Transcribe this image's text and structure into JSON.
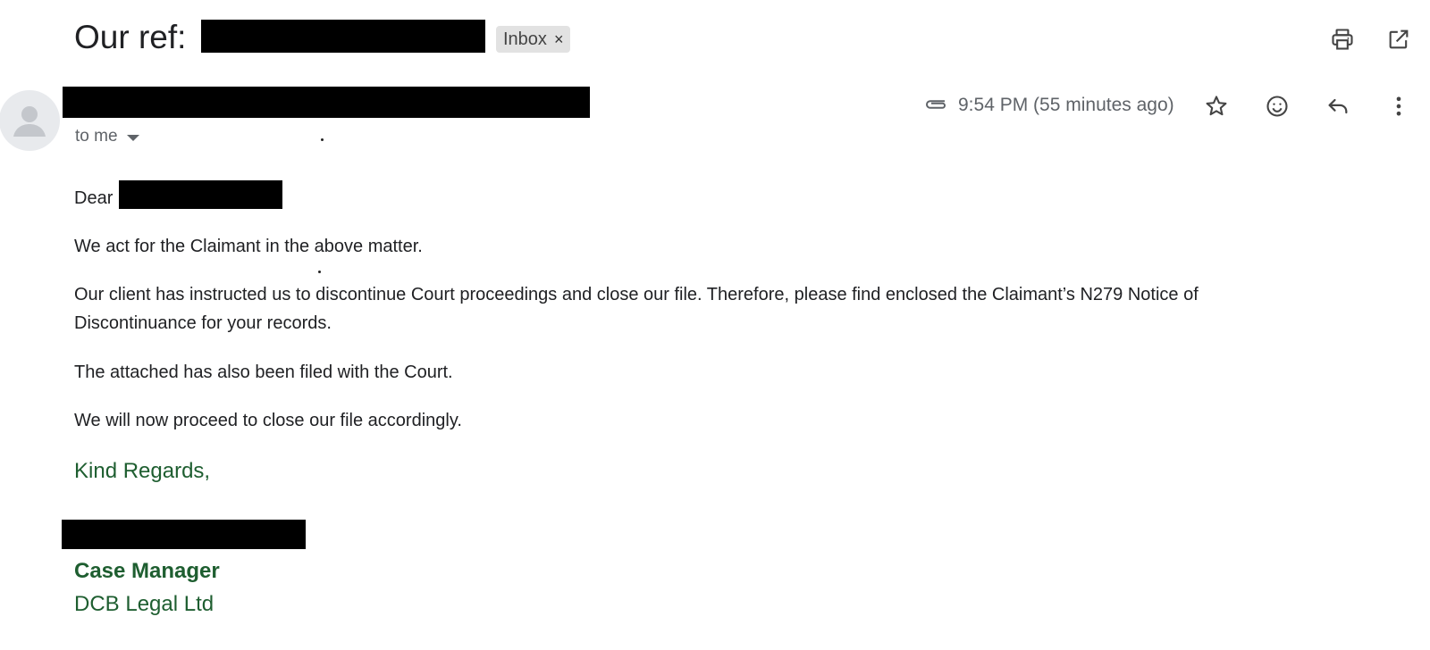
{
  "subject": {
    "prefix": "Our ref:",
    "label_chip": "Inbox",
    "chip_close": "×"
  },
  "message": {
    "recipient": "to me",
    "time": "9:54 PM (55 minutes ago)"
  },
  "body": {
    "greeting": "Dear",
    "p1": "We act for the Claimant in the above matter.",
    "p2_line1": "Our client has instructed us to discontinue Court proceedings and close our file. Therefore, please find enclosed the Claimant’s N279 Notice of",
    "p2_line2": "Discontinuance for your records.",
    "p3": "The attached has also been filed with the Court.",
    "p4": "We will now proceed to close our file accordingly.",
    "closing": "Kind Regards,"
  },
  "signature": {
    "title": "Case Manager",
    "company": "DCB Legal Ltd"
  },
  "icons": {
    "print": "print-icon",
    "open_new_window": "open-in-new-icon",
    "attachment": "paperclip-icon",
    "star": "star-icon",
    "emoji": "emoji-icon",
    "reply": "reply-icon",
    "more": "more-vert-icon",
    "avatar": "person-icon"
  },
  "colors": {
    "signature_green": "#1e5e30",
    "chip_bg": "#e2e2e2"
  }
}
